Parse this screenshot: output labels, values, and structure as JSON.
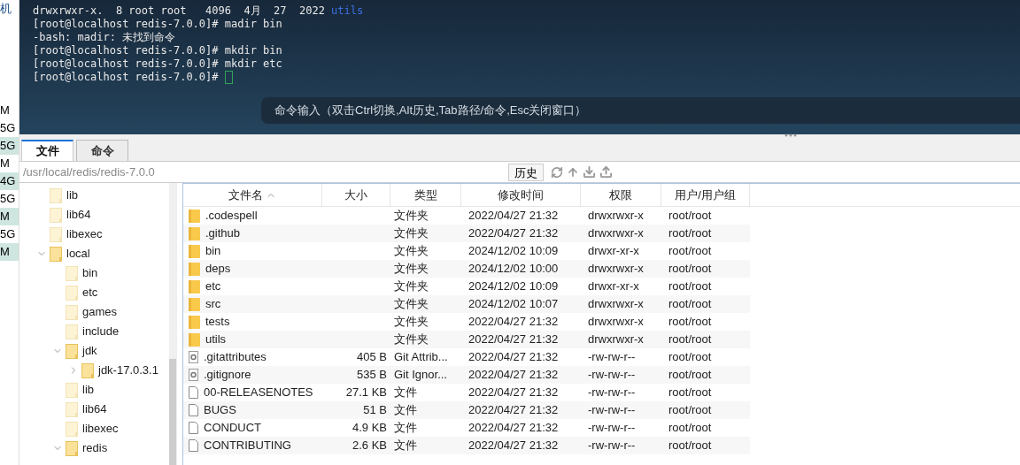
{
  "side_strip": {
    "title": "机",
    "items": [
      {
        "text": "M",
        "highlighted": false
      },
      {
        "text": "5G",
        "highlighted": false
      },
      {
        "text": "5G",
        "highlighted": true
      },
      {
        "text": "M",
        "highlighted": false
      },
      {
        "text": "4G",
        "highlighted": true
      },
      {
        "text": "5G",
        "highlighted": false
      },
      {
        "text": "M",
        "highlighted": true
      },
      {
        "text": "5G",
        "highlighted": false
      },
      {
        "text": "M",
        "highlighted": true
      }
    ]
  },
  "terminal": {
    "lines": [
      {
        "text": "drwxrwxr-x.  8 root root   4096  4月  27  2022 ",
        "dir": "utils",
        "cursor": false
      },
      {
        "text": "[root@localhost redis-7.0.0]# madir bin",
        "cursor": false
      },
      {
        "text": "-bash: madir: 未找到命令",
        "cursor": false
      },
      {
        "text": "[root@localhost redis-7.0.0]# mkdir bin",
        "cursor": false
      },
      {
        "text": "[root@localhost redis-7.0.0]# mkdir etc",
        "cursor": false
      },
      {
        "text": "[root@localhost redis-7.0.0]# ",
        "cursor": true
      }
    ],
    "command_hint": "命令输入（双击Ctrl切换,Alt历史,Tab路径/命令,Esc关闭窗口）"
  },
  "tabs": [
    {
      "label": "文件",
      "selected": true
    },
    {
      "label": "命令",
      "selected": false
    }
  ],
  "path_bar": {
    "path": "/usr/local/redis/redis-7.0.0",
    "history_button": "历史"
  },
  "tree": [
    {
      "label": "lib",
      "has_children": false
    },
    {
      "label": "lib64",
      "has_children": false
    },
    {
      "label": "libexec",
      "has_children": false
    },
    {
      "label": "local",
      "has_children": true,
      "expanded": true,
      "children": [
        {
          "label": "bin",
          "has_children": false
        },
        {
          "label": "etc",
          "has_children": false
        },
        {
          "label": "games",
          "has_children": false
        },
        {
          "label": "include",
          "has_children": false
        },
        {
          "label": "jdk",
          "has_children": true,
          "expanded": true,
          "children": [
            {
              "label": "jdk-17.0.3.1",
              "has_children": true,
              "expanded": false
            }
          ]
        },
        {
          "label": "lib",
          "has_children": false
        },
        {
          "label": "lib64",
          "has_children": false
        },
        {
          "label": "libexec",
          "has_children": false
        },
        {
          "label": "redis",
          "has_children": true,
          "expanded": true
        }
      ]
    }
  ],
  "table": {
    "columns": [
      {
        "label": "文件名",
        "sorted": true
      },
      {
        "label": "大小",
        "sorted": false
      },
      {
        "label": "类型",
        "sorted": false
      },
      {
        "label": "修改时间",
        "sorted": false
      },
      {
        "label": "权限",
        "sorted": false
      },
      {
        "label": "用户/用户组",
        "sorted": false
      }
    ],
    "rows": [
      {
        "kind": "folder",
        "name": ".codespell",
        "size": "",
        "type": "文件夹",
        "modified": "2022/04/27 21:32",
        "perm": "drwxrwxr-x",
        "owner": "root/root"
      },
      {
        "kind": "folder",
        "name": ".github",
        "size": "",
        "type": "文件夹",
        "modified": "2022/04/27 21:32",
        "perm": "drwxrwxr-x",
        "owner": "root/root"
      },
      {
        "kind": "folder",
        "name": "bin",
        "size": "",
        "type": "文件夹",
        "modified": "2024/12/02 10:09",
        "perm": "drwxr-xr-x",
        "owner": "root/root"
      },
      {
        "kind": "folder",
        "name": "deps",
        "size": "",
        "type": "文件夹",
        "modified": "2024/12/02 10:00",
        "perm": "drwxrwxr-x",
        "owner": "root/root"
      },
      {
        "kind": "folder",
        "name": "etc",
        "size": "",
        "type": "文件夹",
        "modified": "2024/12/02 10:09",
        "perm": "drwxr-xr-x",
        "owner": "root/root"
      },
      {
        "kind": "folder",
        "name": "src",
        "size": "",
        "type": "文件夹",
        "modified": "2024/12/02 10:07",
        "perm": "drwxrwxr-x",
        "owner": "root/root"
      },
      {
        "kind": "folder",
        "name": "tests",
        "size": "",
        "type": "文件夹",
        "modified": "2022/04/27 21:32",
        "perm": "drwxrwxr-x",
        "owner": "root/root"
      },
      {
        "kind": "folder",
        "name": "utils",
        "size": "",
        "type": "文件夹",
        "modified": "2022/04/27 21:32",
        "perm": "drwxrwxr-x",
        "owner": "root/root"
      },
      {
        "kind": "config",
        "name": ".gitattributes",
        "size": "405 B",
        "type": "Git Attrib...",
        "modified": "2022/04/27 21:32",
        "perm": "-rw-rw-r--",
        "owner": "root/root"
      },
      {
        "kind": "config",
        "name": ".gitignore",
        "size": "535 B",
        "type": "Git Ignor...",
        "modified": "2022/04/27 21:32",
        "perm": "-rw-rw-r--",
        "owner": "root/root"
      },
      {
        "kind": "file",
        "name": "00-RELEASENOTES",
        "size": "27.1 KB",
        "type": "文件",
        "modified": "2022/04/27 21:32",
        "perm": "-rw-rw-r--",
        "owner": "root/root"
      },
      {
        "kind": "file",
        "name": "BUGS",
        "size": "51 B",
        "type": "文件",
        "modified": "2022/04/27 21:32",
        "perm": "-rw-rw-r--",
        "owner": "root/root"
      },
      {
        "kind": "file",
        "name": "CONDUCT",
        "size": "4.9 KB",
        "type": "文件",
        "modified": "2022/04/27 21:32",
        "perm": "-rw-rw-r--",
        "owner": "root/root"
      },
      {
        "kind": "file",
        "name": "CONTRIBUTING",
        "size": "2.6 KB",
        "type": "文件",
        "modified": "2022/04/27 21:32",
        "perm": "-rw-rw-r--",
        "owner": "root/root"
      }
    ]
  }
}
